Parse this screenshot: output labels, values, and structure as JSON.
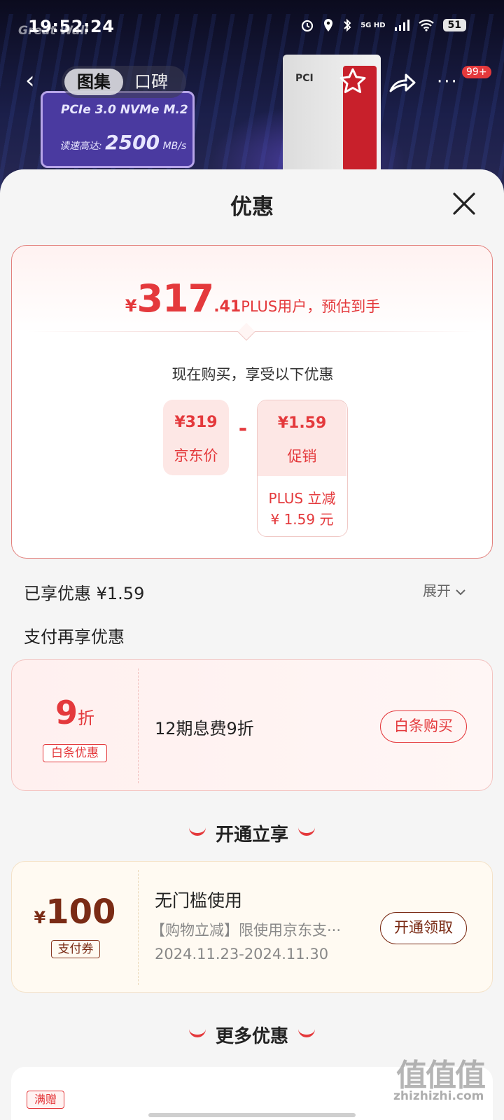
{
  "status_bar": {
    "time": "19:52:24",
    "network": "5G HD",
    "battery": "51"
  },
  "background": {
    "brand_watermark": "Great Wall",
    "product_line1": "PCIe 3.0 NVMe  M.2",
    "product_speed_label": "读速高达:",
    "product_speed_value": "2500",
    "product_speed_unit": "MB/s",
    "ssd_label": "PCI"
  },
  "nav": {
    "tabs": [
      "图集",
      "口碑"
    ],
    "badge": "99+"
  },
  "sheet": {
    "title": "优惠",
    "estimate": {
      "currency": "¥",
      "integer": "317",
      "decimal": ".41",
      "label": "PLUS用户，预估到手"
    },
    "buy_now_text": "现在购买，享受以下优惠",
    "breakdown": {
      "jd_price": "¥319",
      "jd_price_label": "京东价",
      "minus": "-",
      "promo_value": "¥1.59",
      "promo_label": "促销",
      "promo_note_line1": "PLUS 立减",
      "promo_note_line2": "¥ 1.59 元"
    },
    "enjoyed": "已享优惠 ¥1.59",
    "expand": "展开",
    "pay_more_title": "支付再享优惠",
    "baitiao": {
      "discount_num": "9",
      "discount_unit": "折",
      "tag": "白条优惠",
      "desc": "12期息费9折",
      "button": "白条购买"
    },
    "open_section_title": "开通立享",
    "coupon": {
      "currency": "¥",
      "amount": "100",
      "tag": "支付券",
      "title": "无门槛使用",
      "desc": "【购物立减】限使用京东支···",
      "dates": "2024.11.23-2024.11.30",
      "button": "开通领取"
    },
    "more_section_title": "更多优惠",
    "more_tag": "满赠"
  },
  "watermark": {
    "logo": "值值值",
    "site": "zhizhizhi.com"
  },
  "colors": {
    "accent_red": "#e4393c",
    "coupon_brown": "#7a2b15"
  }
}
